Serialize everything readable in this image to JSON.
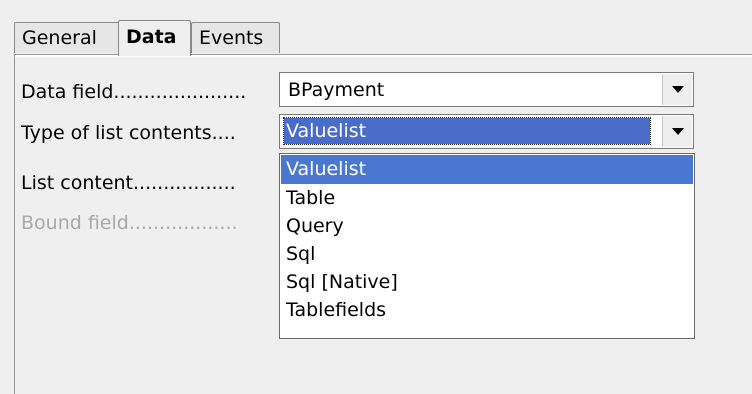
{
  "tabs": [
    {
      "label": "General",
      "active": false
    },
    {
      "label": "Data",
      "active": true
    },
    {
      "label": "Events",
      "active": false
    }
  ],
  "fields": {
    "data_field": {
      "label": "Data field......................",
      "value": "BPayment"
    },
    "type_of_list": {
      "label": "Type of list contents....",
      "value": "Valuelist"
    },
    "list_content": {
      "label": "List content................."
    },
    "bound_field": {
      "label": "Bound field..................",
      "disabled": true
    }
  },
  "dropdown": {
    "options": [
      "Valuelist",
      "Table",
      "Query",
      "Sql",
      "Sql [Native]",
      "Tablefields"
    ],
    "highlighted": "Valuelist"
  },
  "icons": {
    "dropdown_button": "chevron-down-icon"
  }
}
